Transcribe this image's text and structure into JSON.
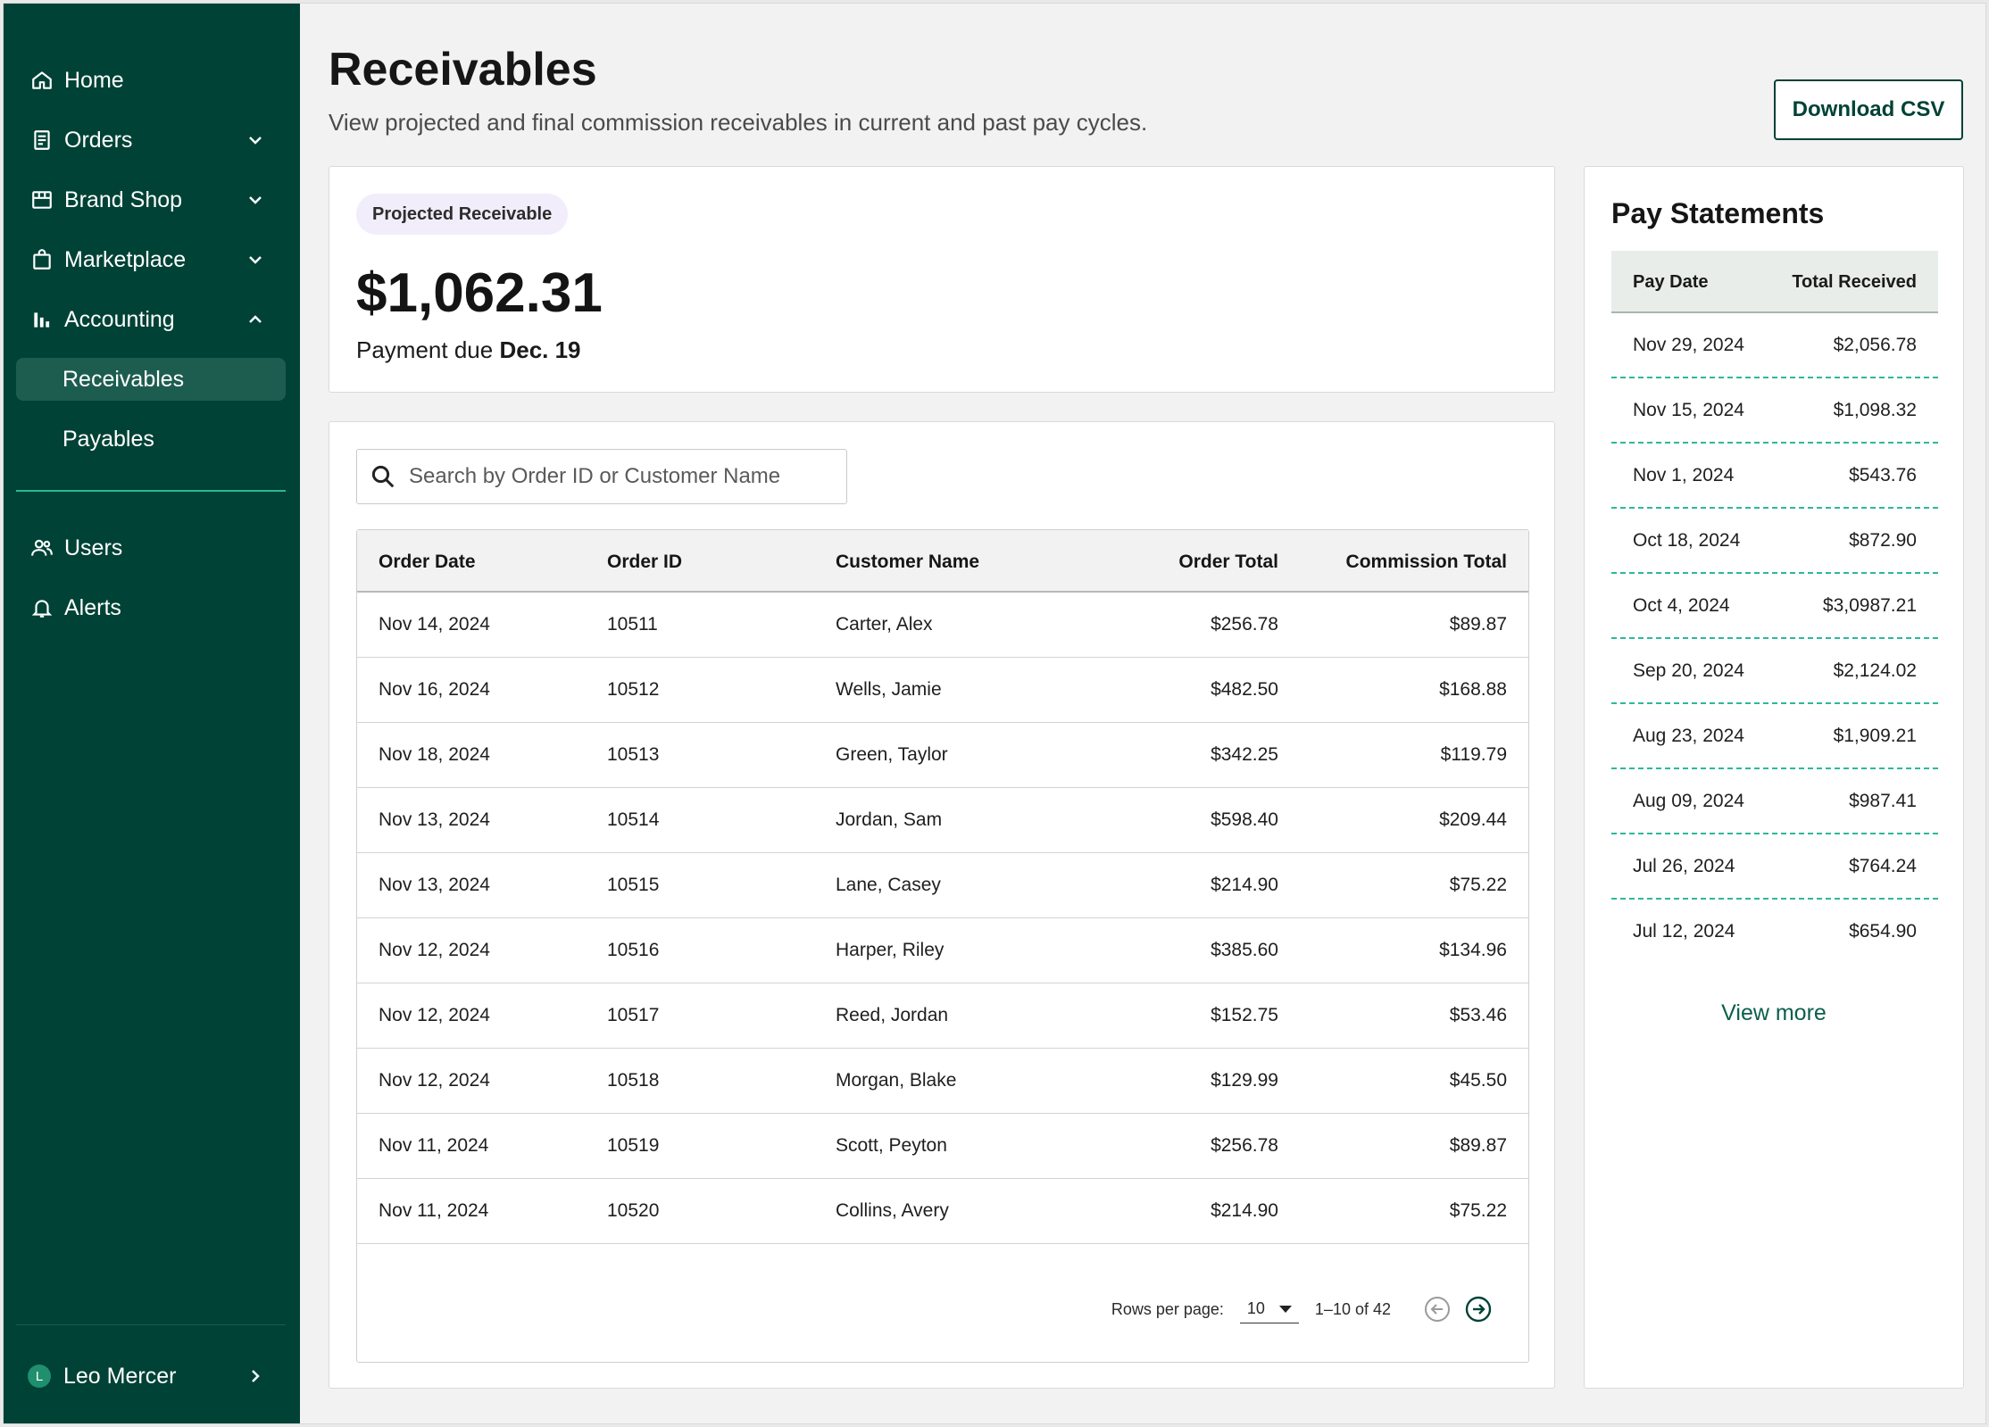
{
  "sidebar": {
    "items": [
      {
        "label": "Home",
        "icon": "home-icon"
      },
      {
        "label": "Orders",
        "icon": "receipt-icon"
      },
      {
        "label": "Brand Shop",
        "icon": "storefront-icon"
      },
      {
        "label": "Marketplace",
        "icon": "shopping-bag-icon"
      },
      {
        "label": "Accounting",
        "icon": "bar-chart-icon"
      }
    ],
    "sub_items": [
      {
        "label": "Receivables"
      },
      {
        "label": "Payables"
      }
    ],
    "secondary_items": [
      {
        "label": "Users",
        "icon": "users-icon"
      },
      {
        "label": "Alerts",
        "icon": "bell-icon"
      }
    ],
    "user": {
      "initial": "L",
      "name": "Leo Mercer"
    }
  },
  "header": {
    "title": "Receivables",
    "subtitle": "View projected and final commission receivables in current and past pay cycles.",
    "download_label": "Download CSV"
  },
  "projected": {
    "chip": "Projected Receivable",
    "amount": "$1,062.31",
    "due_prefix": "Payment due",
    "due_date": "Dec. 19"
  },
  "search": {
    "placeholder": "Search by Order ID or Customer Name"
  },
  "table": {
    "headers": [
      "Order Date",
      "Order ID",
      "Customer Name",
      "Order Total",
      "Commission Total"
    ],
    "rows": [
      [
        "Nov 14, 2024",
        "10511",
        "Carter, Alex",
        "$256.78",
        "$89.87"
      ],
      [
        "Nov 16, 2024",
        "10512",
        "Wells, Jamie",
        "$482.50",
        "$168.88"
      ],
      [
        "Nov 18, 2024",
        "10513",
        "Green, Taylor",
        "$342.25",
        "$119.79"
      ],
      [
        "Nov 13, 2024",
        "10514",
        "Jordan, Sam",
        "$598.40",
        "$209.44"
      ],
      [
        "Nov 13, 2024",
        "10515",
        "Lane, Casey",
        "$214.90",
        "$75.22"
      ],
      [
        "Nov 12, 2024",
        "10516",
        "Harper, Riley",
        "$385.60",
        "$134.96"
      ],
      [
        "Nov 12, 2024",
        "10517",
        "Reed, Jordan",
        "$152.75",
        "$53.46"
      ],
      [
        "Nov 12, 2024",
        "10518",
        "Morgan, Blake",
        "$129.99",
        "$45.50"
      ],
      [
        "Nov 11, 2024",
        "10519",
        "Scott, Peyton",
        "$256.78",
        "$89.87"
      ],
      [
        "Nov 11, 2024",
        "10520",
        "Collins, Avery",
        "$214.90",
        "$75.22"
      ]
    ]
  },
  "pagination": {
    "rows_per_page_label": "Rows per page:",
    "rows_per_page": "10",
    "range": "1–10 of 42"
  },
  "pay_statements": {
    "title": "Pay Statements",
    "headers": [
      "Pay Date",
      "Total Received"
    ],
    "rows": [
      [
        "Nov 29, 2024",
        "$2,056.78"
      ],
      [
        "Nov 15, 2024",
        "$1,098.32"
      ],
      [
        "Nov 1, 2024",
        "$543.76"
      ],
      [
        "Oct 18, 2024",
        "$872.90"
      ],
      [
        "Oct 4, 2024",
        "$3,0987.21"
      ],
      [
        "Sep 20, 2024",
        "$2,124.02"
      ],
      [
        "Aug 23, 2024",
        "$1,909.21"
      ],
      [
        "Aug 09, 2024",
        "$987.41"
      ],
      [
        "Jul 26, 2024",
        "$764.24"
      ],
      [
        "Jul 12, 2024",
        "$654.90"
      ]
    ],
    "view_more": "View more"
  },
  "colors": {
    "sidebar_bg": "#004236",
    "sidebar_active": "#1d5d50",
    "accent": "#2cb89a",
    "chip_bg": "#f1edfa"
  }
}
